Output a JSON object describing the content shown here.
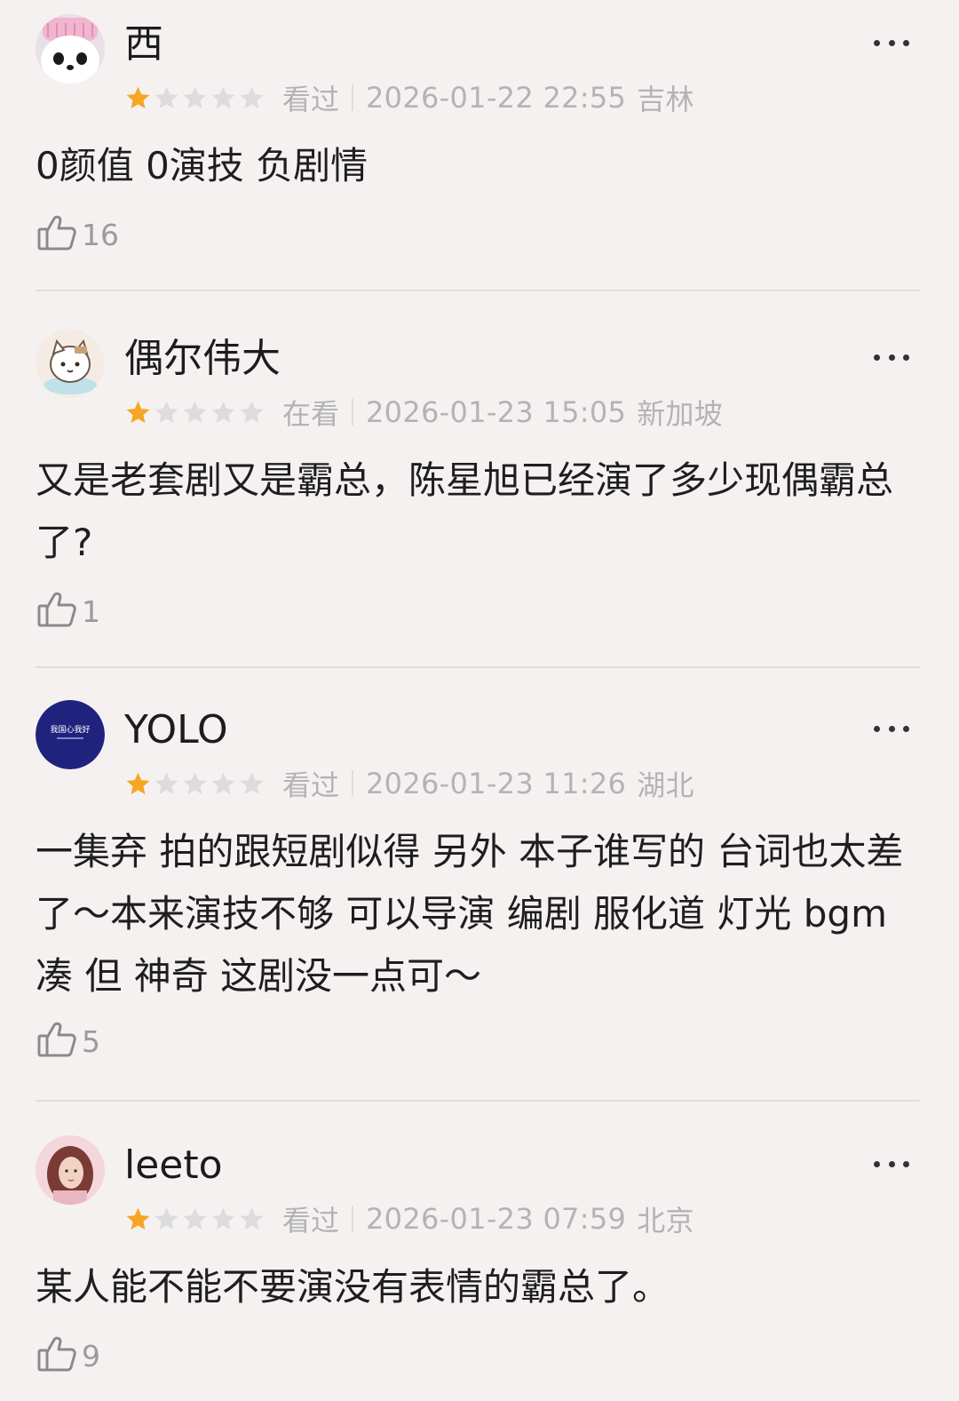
{
  "reviews": [
    {
      "username": "西",
      "avatar": "panda-avatar",
      "rating": 1,
      "status": "看过",
      "time": "2026-01-22 22:55",
      "location": "吉林",
      "text": "0颜值 0演技 负剧情",
      "likes": "16"
    },
    {
      "username": "偶尔伟大",
      "avatar": "cat-avatar",
      "rating": 1,
      "status": "在看",
      "time": "2026-01-23 15:05",
      "location": "新加坡",
      "text": "又是老套剧又是霸总，陈星旭已经演了多少现偶霸总了?",
      "likes": "1"
    },
    {
      "username": "YOLO",
      "avatar": "blue-badge-avatar",
      "rating": 1,
      "status": "看过",
      "time": "2026-01-23 11:26",
      "location": "湖北",
      "text": "一集弃 拍的跟短剧似得 另外 本子谁写的 台词也太差了～本来演技不够 可以导演 编剧 服化道 灯光 bgm凑 但 神奇 这剧没一点可～",
      "likes": "5"
    },
    {
      "username": "leeto",
      "avatar": "portrait-avatar",
      "rating": 1,
      "status": "看过",
      "time": "2026-01-23 07:59",
      "location": "北京",
      "text": "某人能不能不要演没有表情的霸总了。",
      "likes": "9"
    }
  ],
  "colors": {
    "background": "#f6f1f1",
    "star_filled": "#f5a623",
    "star_empty": "#dcdcdc",
    "meta_text": "#b3b3b3",
    "like_icon": "#8a8a8a"
  },
  "icons": {
    "more": "more-dots-icon",
    "like": "thumbs-up-icon",
    "star": "star-icon"
  },
  "avatar_badge_text": "我国心我好"
}
